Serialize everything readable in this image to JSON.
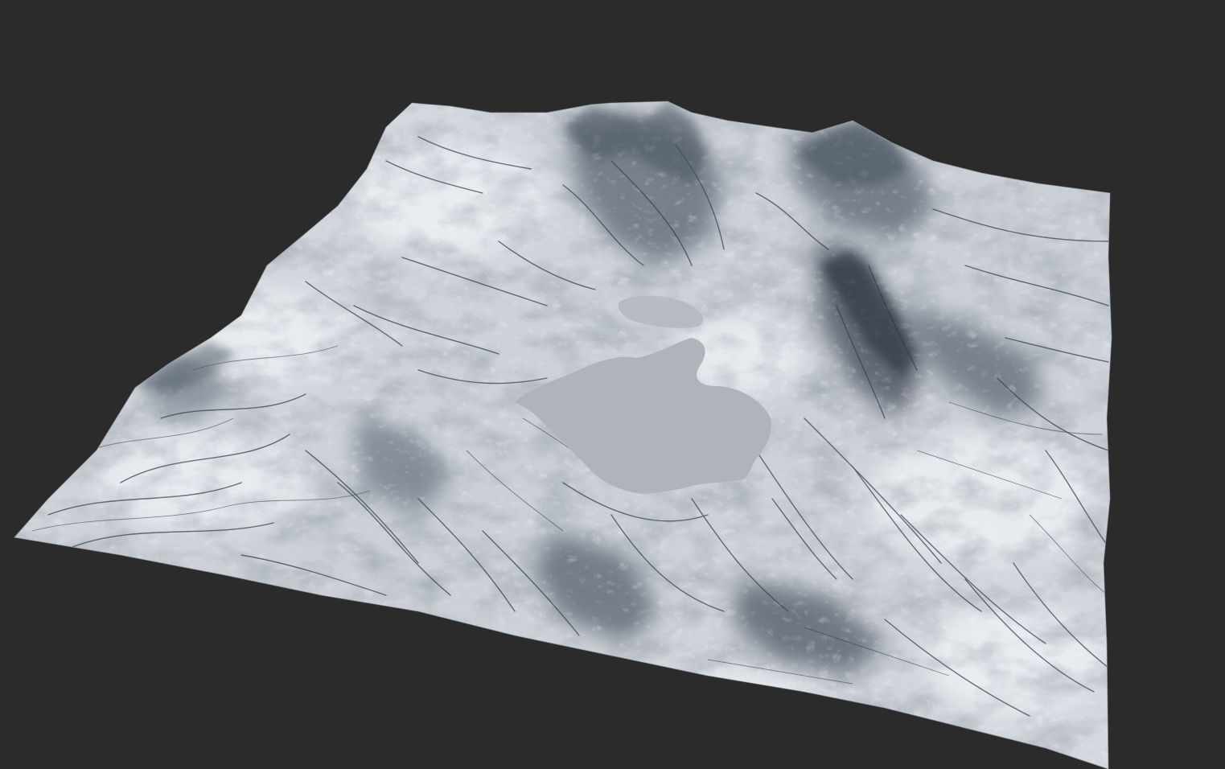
{
  "scene": {
    "background_color": "#2b2b2b",
    "subject": "terrain-heightfield-render",
    "colors": {
      "terrain_light": "#e6eaee",
      "terrain_mid": "#b9c0c8",
      "terrain_dark": "#4a5462",
      "terrain_shadow": "#2f3742",
      "lake": "#aeb4ba",
      "erosion_line": "#3a4350"
    }
  }
}
